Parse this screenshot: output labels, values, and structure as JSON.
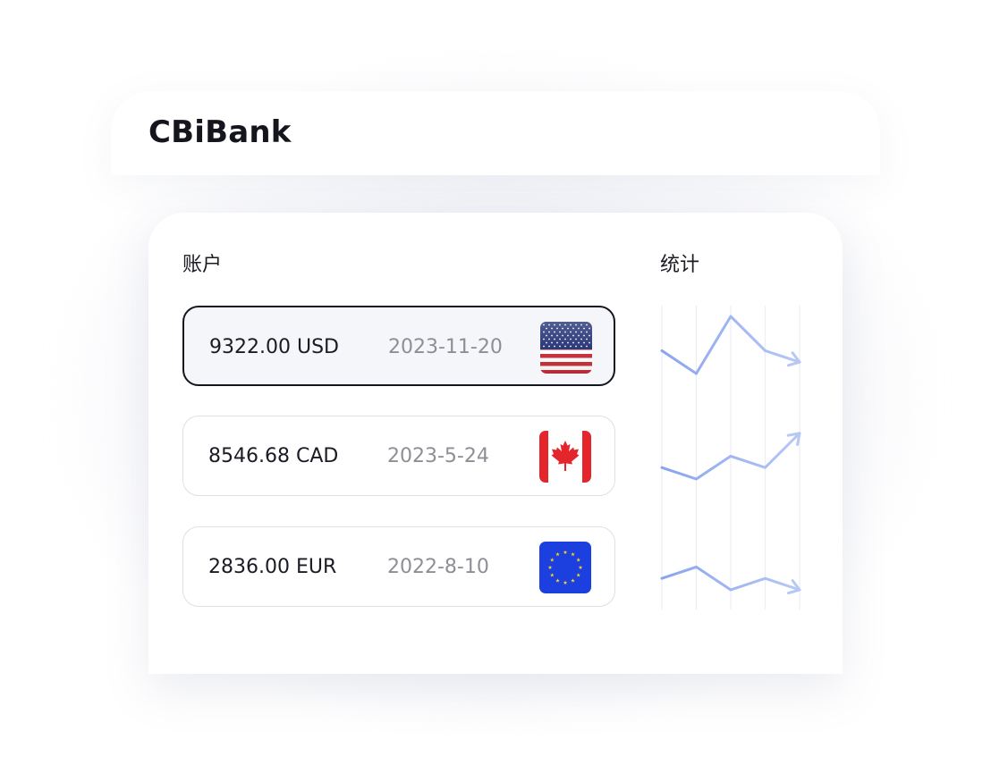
{
  "app": {
    "brand": "CBiBank"
  },
  "sections": {
    "accounts_title": "账户",
    "stats_title": "统计"
  },
  "accounts": [
    {
      "amount": "9322.00 USD",
      "date": "2023-11-20",
      "flag_icon": "us-flag-icon",
      "selected": true
    },
    {
      "amount": "8546.68 CAD",
      "date": "2023-5-24",
      "flag_icon": "canada-flag-icon",
      "selected": false
    },
    {
      "amount": "2836.00 EUR",
      "date": "2022-8-10",
      "flag_icon": "eu-flag-icon",
      "selected": false
    }
  ],
  "chart_data": {
    "type": "line",
    "series": [
      {
        "values": [
          3,
          1,
          6,
          3,
          2
        ]
      },
      {
        "values": [
          2,
          1,
          3,
          2,
          5
        ]
      },
      {
        "values": [
          2,
          3,
          1,
          2,
          1
        ]
      }
    ],
    "grid": true
  },
  "colors": {
    "accent_line": "#8ea9f0",
    "selected_border": "#15151e",
    "card_border": "#dfe0e4"
  }
}
